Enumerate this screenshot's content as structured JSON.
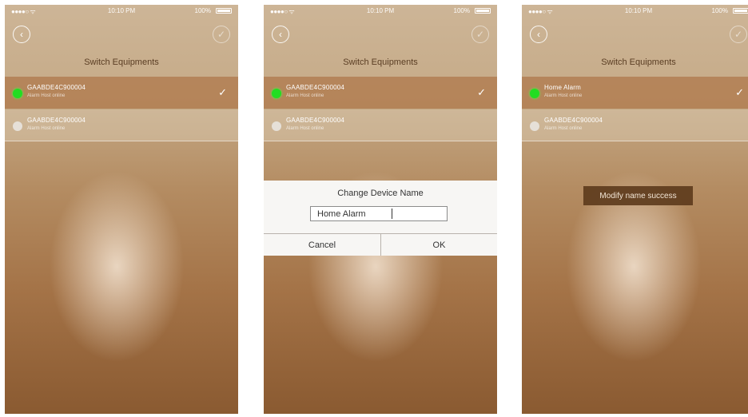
{
  "status": {
    "carrier": "●●●●○ ᯤ",
    "screen1_time": "10:10 PM",
    "screen2_time": "10:10 PM",
    "screen3_time": "10:10 PM",
    "battery_pct": "100%"
  },
  "header": {
    "title": "Switch Equipments",
    "back_icon": "back-arrow-icon",
    "confirm_icon": "checkmark-circle-icon"
  },
  "devices": [
    {
      "name": "GAABDE4C900004",
      "subtitle": "Alarm Host online",
      "selected": true
    },
    {
      "name": "GAABDE4C900004",
      "subtitle": "Alarm Host online",
      "selected": false
    }
  ],
  "renamed_device": {
    "name": "Home Alarm",
    "subtitle": "Alarm Host online"
  },
  "dialog": {
    "title": "Change Device Name",
    "input_value": "Home Alarm",
    "cancel_label": "Cancel",
    "ok_label": "OK"
  },
  "toast": {
    "message": "Modify name success"
  },
  "colors": {
    "online_dot": "#22dd22",
    "offline_dot": "#e6e0d8",
    "selected_row": "#af784b"
  }
}
